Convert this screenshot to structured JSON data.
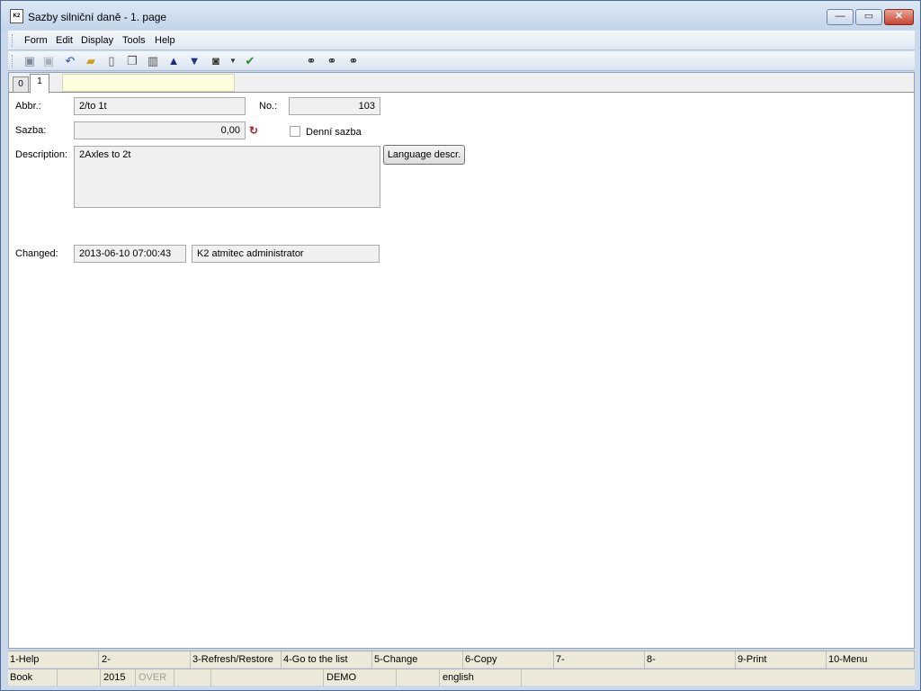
{
  "window": {
    "title": "Sazby silniční daně - 1. page",
    "app_icon": "K2",
    "controls": {
      "minimize": "—",
      "maximize": "▭",
      "close": "✕"
    }
  },
  "menu": {
    "items": [
      "Form",
      "Edit",
      "Display",
      "Tools",
      "Help"
    ]
  },
  "toolbar": {
    "icons": [
      "save-icon",
      "save-disabled-icon",
      "undo-icon",
      "open-folder-icon",
      "new-document-icon",
      "copy-icon",
      "book-icon",
      "arrow-up-icon",
      "arrow-down-icon",
      "camera-icon",
      "dropdown-arrow-icon",
      "run-icon",
      "binoculars-icon",
      "find-next-icon",
      "find-replace-icon"
    ]
  },
  "tabs": {
    "items": [
      "0",
      "1"
    ],
    "active": "1",
    "search_value": ""
  },
  "form": {
    "abbr": {
      "label": "Abbr.:",
      "value": "2/to 1t"
    },
    "no": {
      "label": "No.:",
      "value": "103"
    },
    "sazba": {
      "label": "Sazba:",
      "value": "0,00"
    },
    "denni_sazba": {
      "label": "Denní sazba",
      "checked": false
    },
    "description": {
      "label": "Description:",
      "value": "2Axles to 2t"
    },
    "language_button": "Language descr.",
    "changed": {
      "label": "Changed:",
      "date": "2013-06-10 07:00:43",
      "user": "K2 atmitec administrator"
    }
  },
  "function_keys": [
    "1-Help",
    "2-",
    "3-Refresh/Restore",
    "4-Go to the list",
    "5-Change",
    "6-Copy",
    "7-",
    "8-",
    "9-Print",
    "10-Menu"
  ],
  "status": {
    "book": "Book",
    "year": "2015",
    "mode": "OVER",
    "db": "DEMO",
    "language": "english"
  }
}
